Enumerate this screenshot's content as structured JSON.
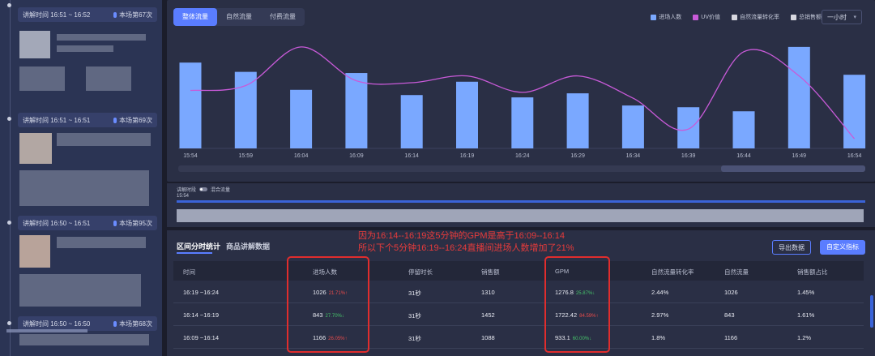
{
  "sidebar": {
    "segments": [
      {
        "time": "讲解时间 16:51 ~ 16:52",
        "count": "本场第67次"
      },
      {
        "time": "讲解时间 16:51 ~ 16:51",
        "count": "本场第69次"
      },
      {
        "time": "讲解时间 16:50 ~ 16:51",
        "count": "本场第95次"
      },
      {
        "time": "讲解时间 16:50 ~ 16:50",
        "count": "本场第68次"
      }
    ]
  },
  "chart_panel": {
    "tabs": [
      "整体流量",
      "自然流量",
      "付费流量"
    ],
    "active_tab": "整体流量",
    "time_select": "一小时",
    "legend": [
      {
        "label": "进场人数",
        "color": "#7aa8ff"
      },
      {
        "label": "UV价值",
        "color": "#c85ad8"
      },
      {
        "label": "自然流量转化率",
        "color": "#d8d8e0"
      },
      {
        "label": "总销售额",
        "color": "#d8d8e0"
      }
    ]
  },
  "chart_data": {
    "type": "bar",
    "categories": [
      "15:54",
      "15:59",
      "16:04",
      "16:09",
      "16:14",
      "16:19",
      "16:24",
      "16:29",
      "16:34",
      "16:39",
      "16:44",
      "16:49",
      "16:54"
    ],
    "series": [
      {
        "name": "进场人数",
        "type": "bar",
        "color": "#7aa8ff",
        "values": [
          1480,
          1320,
          1010,
          1300,
          920,
          1150,
          880,
          950,
          740,
          710,
          640,
          1750,
          1270
        ]
      },
      {
        "name": "UV价值",
        "type": "line",
        "color": "#c85ad8",
        "values": [
          0.8,
          0.85,
          1.25,
          0.9,
          0.88,
          0.95,
          0.78,
          0.95,
          0.72,
          0.4,
          1.2,
          0.95,
          0.3
        ]
      }
    ],
    "x_tick_labels": [
      "15:54",
      "15:59",
      "16:04",
      "16:09",
      "16:14",
      "16:19",
      "16:24",
      "16:29",
      "16:34",
      "16:39",
      "16:44",
      "16:49",
      "16:54"
    ]
  },
  "timeline": {
    "toggle_left": "讲解时段",
    "toggle_right": "混合流量",
    "start_time": "15:54"
  },
  "table": {
    "tabs": [
      "区间分时统计",
      "商品讲解数据"
    ],
    "buttons": {
      "export": "导出数据",
      "custom": "自定义指标"
    },
    "annotation": [
      "因为16:14--16:19这5分钟的GPM是高于16:09--16:14",
      "所以下个5分钟16:19--16:24直播间进场人数增加了21%"
    ],
    "columns": [
      "时间",
      "进场人数",
      "停留时长",
      "销售额",
      "GPM",
      "自然流量转化率",
      "自然流量",
      "销售额占比"
    ],
    "rows": [
      {
        "time": "16:19 ~16:24",
        "visitors": "1026",
        "visitors_pct": "21.71%↑",
        "visitors_dir": "up",
        "stay": "31秒",
        "sales": "1310",
        "gpm": "1276.8",
        "gpm_pct": "25.87%↓",
        "gpm_dir": "down",
        "conv": "2.44%",
        "natural": "1026",
        "share": "1.45%"
      },
      {
        "time": "16:14 ~16:19",
        "visitors": "843",
        "visitors_pct": "27.70%↓",
        "visitors_dir": "down",
        "stay": "31秒",
        "sales": "1452",
        "gpm": "1722.42",
        "gpm_pct": "84.59%↑",
        "gpm_dir": "up",
        "conv": "2.97%",
        "natural": "843",
        "share": "1.61%"
      },
      {
        "time": "16:09 ~16:14",
        "visitors": "1166",
        "visitors_pct": "26.05%↑",
        "visitors_dir": "up",
        "stay": "31秒",
        "sales": "1088",
        "gpm": "933.1",
        "gpm_pct": "60.00%↓",
        "gpm_dir": "down",
        "conv": "1.8%",
        "natural": "1166",
        "share": "1.2%"
      }
    ]
  }
}
